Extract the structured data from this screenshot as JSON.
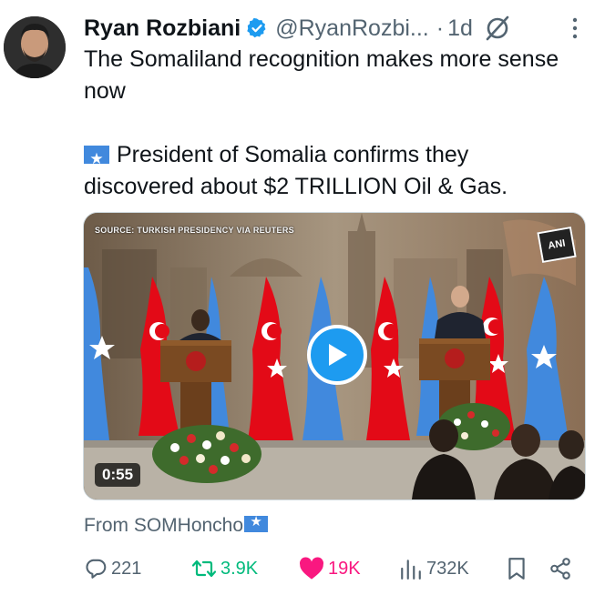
{
  "author": {
    "name": "Ryan Rozbiani",
    "handle": "@RyanRozbi...",
    "separator": "·",
    "time": "1d",
    "verified": true
  },
  "tweet": {
    "line1": "The Somaliland recognition makes more sense now",
    "line2": "President of Somalia confirms they discovered about $2 TRILLION Oil & Gas."
  },
  "media": {
    "source_label": "SOURCE: TURKISH PRESIDENCY VIA REUTERS",
    "watermark": "ANI",
    "duration": "0:55"
  },
  "attribution": {
    "label": "From SOMHoncho"
  },
  "actions": {
    "replies": "221",
    "reposts": "3.9K",
    "likes": "19K",
    "views": "732K"
  },
  "colors": {
    "verified": "#1d9bf0",
    "repost_active": "#00ba7c",
    "like_active": "#f91880",
    "muted": "#536471",
    "play_button": "#1d9bf0",
    "somalia_flag": "#4189dd",
    "turkey_flag": "#e30a17"
  },
  "icons": {
    "verified": "verified-badge-icon",
    "grok": "grok-icon",
    "more": "more-dots-icon",
    "play": "play-icon",
    "reply": "reply-icon",
    "repost": "repost-icon",
    "like": "heart-icon",
    "views": "views-icon",
    "bookmark": "bookmark-icon",
    "share": "share-icon"
  }
}
